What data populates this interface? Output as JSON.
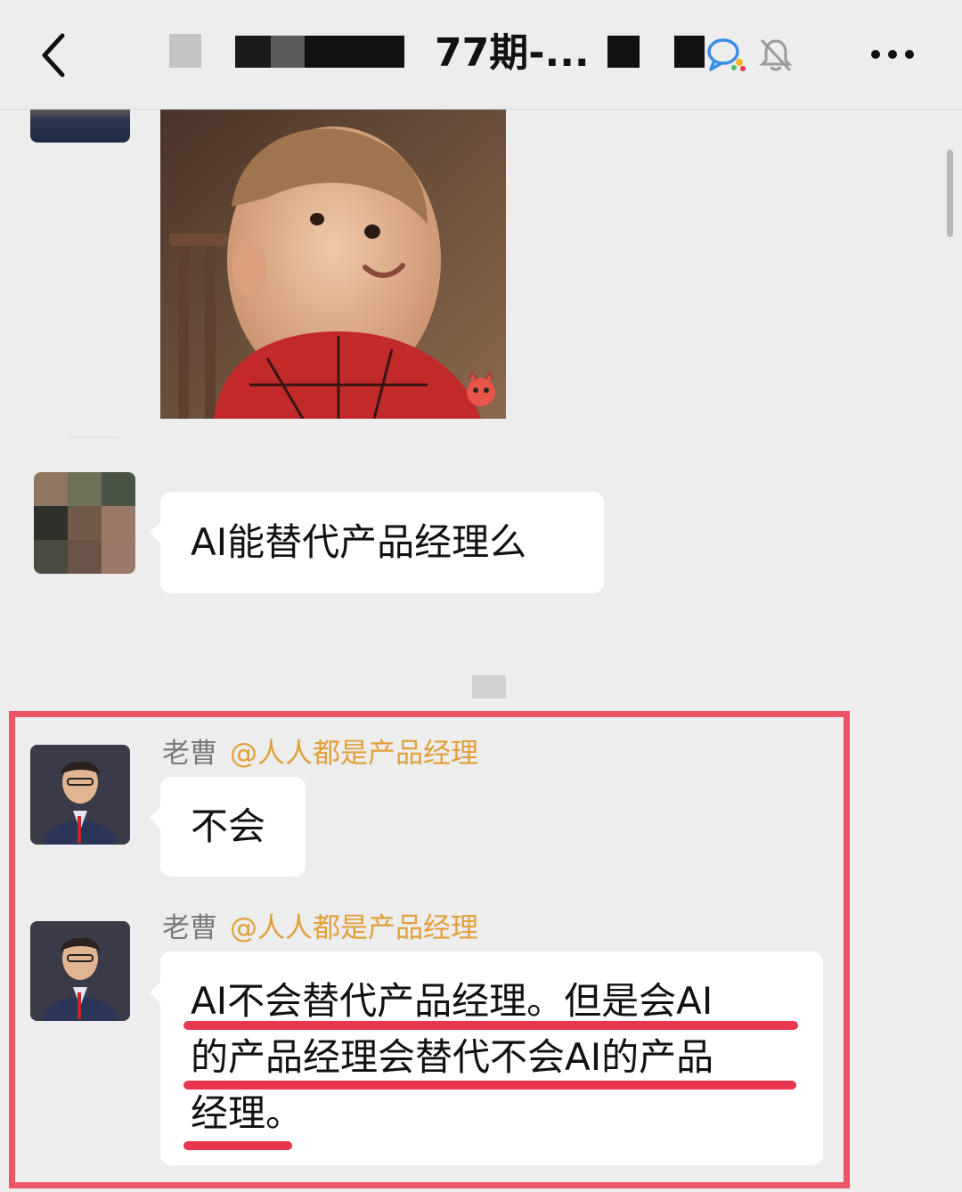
{
  "header": {
    "title": "77期-...",
    "back_icon": "chevron-left-icon",
    "chat_icon": "chat-bubble-icon",
    "mute_icon": "bell-muted-icon",
    "more_icon": "more-dots-icon"
  },
  "messages": [
    {
      "type": "image",
      "description": "meme-child"
    },
    {
      "type": "text",
      "text": "AI能替代产品经理么"
    },
    {
      "type": "text",
      "sender": "老曹",
      "mention": "@人人都是产品经理",
      "text": "不会"
    },
    {
      "type": "text",
      "sender": "老曹",
      "mention": "@人人都是产品经理",
      "lines": [
        "AI不会替代产品经理。但是会AI",
        "的产品经理会替代不会AI的产品",
        "经理。"
      ]
    }
  ],
  "colors": {
    "background": "#ededed",
    "bubble": "#ffffff",
    "mention": "#e0a03a",
    "highlight": "#ec5565",
    "underline": "#e8364e"
  }
}
